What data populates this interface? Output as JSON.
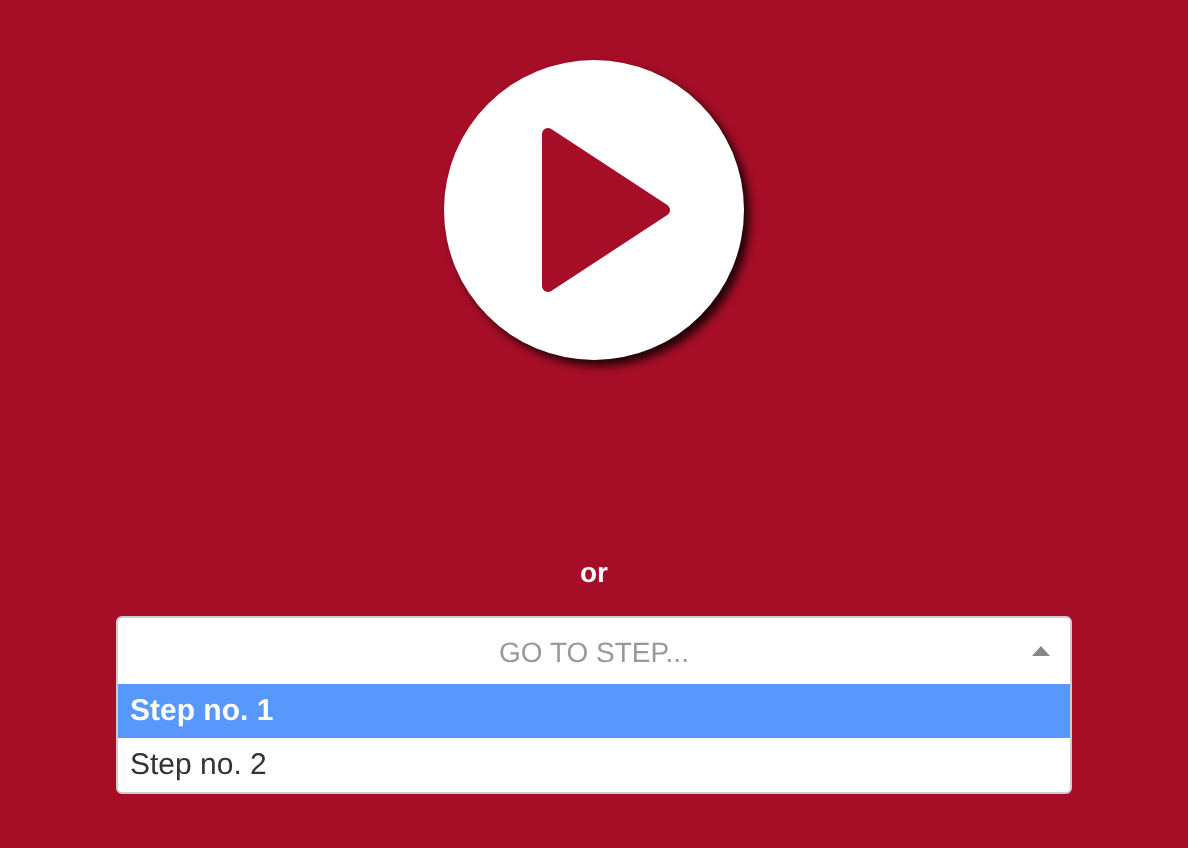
{
  "separator": "or",
  "step_select": {
    "placeholder": "GO TO STEP...",
    "expanded": true,
    "options": [
      {
        "label": "Step no. 1",
        "selected": true
      },
      {
        "label": "Step no. 2",
        "selected": false
      }
    ]
  }
}
